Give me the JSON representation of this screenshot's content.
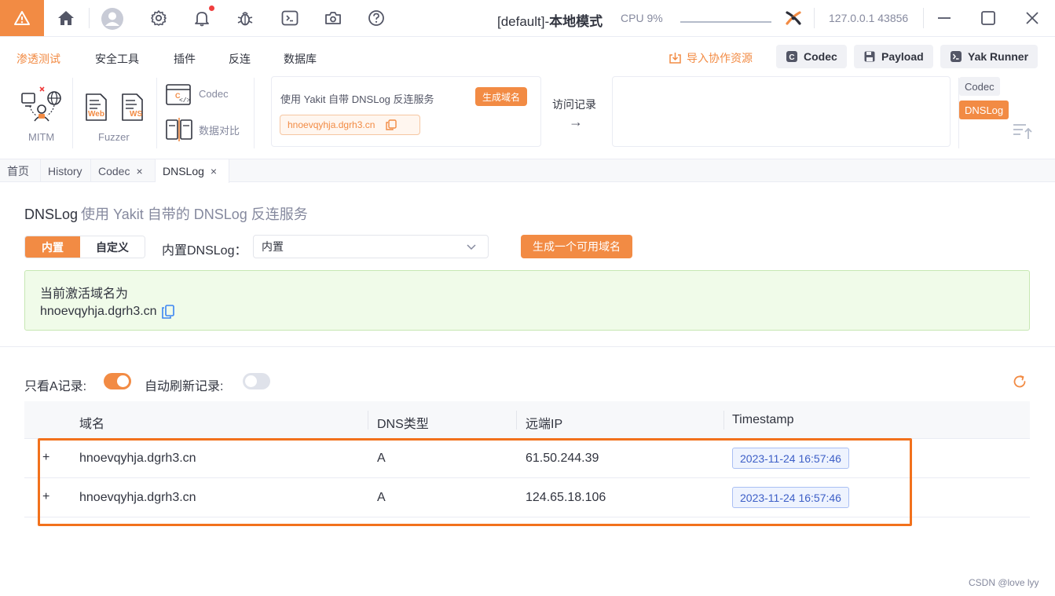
{
  "titlebar": {
    "title_prefix": "[default]-",
    "title_mode": "本地模式",
    "cpu": "CPU 9%",
    "ip": "127.0.0.1 43856",
    "icons": [
      "warning-icon",
      "home-icon",
      "user-icon",
      "gear-icon",
      "bell-icon",
      "bug-icon",
      "terminal-icon",
      "camera-icon",
      "help-icon",
      "yak-logo-icon",
      "minimize-icon",
      "maximize-icon",
      "close-icon"
    ]
  },
  "menu": {
    "items": [
      "渗透测试",
      "安全工具",
      "插件",
      "反连",
      "数据库"
    ],
    "import_label": "导入协作资源",
    "buttons": [
      "Codec",
      "Payload",
      "Yak Runner"
    ]
  },
  "toolbox": {
    "mitm": "MITM",
    "fuzzer": "Fuzzer",
    "web_tag": "Web",
    "ws_tag": "WS",
    "codec": "Codec",
    "compare": "数据对比",
    "dns_card_title": "使用 Yakit 自带 DNSLog 反连服务",
    "dns_card_button": "生成域名",
    "dns_card_domain": "hnoevqyhja.dgrh3.cn",
    "visit_label": "访问记录",
    "visit_arrow": "→",
    "side_tabs": [
      "Codec",
      "DNSLog"
    ]
  },
  "tabs": {
    "home": "首页",
    "history": "History",
    "codec": "Codec",
    "dnslog": "DNSLog",
    "close": "×"
  },
  "main": {
    "heading": "DNSLog",
    "subheading": "使用 Yakit 自带的 DNSLog 反连服务",
    "mode_builtin": "内置",
    "mode_custom": "自定义",
    "select_label": "内置DNSLog：",
    "select_value": "内置",
    "generate_button": "生成一个可用域名",
    "active_title": "当前激活域名为",
    "active_domain": "hnoevqyhja.dgrh3.cn",
    "only_a_label": "只看A记录:",
    "auto_refresh_label": "自动刷新记录:",
    "only_a_on": true,
    "auto_refresh_on": false
  },
  "table": {
    "columns": [
      "域名",
      "DNS类型",
      "远端IP",
      "Timestamp"
    ],
    "rows": [
      {
        "domain": "hnoevqyhja.dgrh3.cn",
        "type": "A",
        "ip": "61.50.244.39",
        "timestamp": "2023-11-24 16:57:46"
      },
      {
        "domain": "hnoevqyhja.dgrh3.cn",
        "type": "A",
        "ip": "124.65.18.106",
        "timestamp": "2023-11-24 16:57:46"
      }
    ],
    "expand_symbol": "+"
  },
  "footer": {
    "credit": "CSDN @love lyy"
  },
  "colors": {
    "accent": "#f28b44",
    "highlight": "#f2711c",
    "success_bg": "#f0fbe9",
    "tag_blue": "#3d5fc7"
  }
}
